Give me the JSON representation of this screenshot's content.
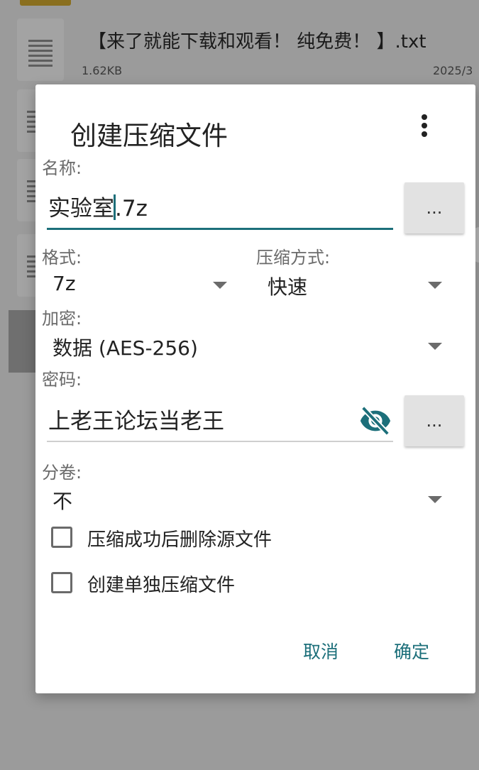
{
  "background": {
    "file_name": "【来了就能下载和观看！ 纯免费！ 】.txt",
    "file_size": "1.62KB",
    "file_date": "2025/3"
  },
  "dialog": {
    "title": "创建压缩文件",
    "name_label": "名称:",
    "name_value_before_caret": "实验室",
    "name_value_after_caret": ".7z",
    "browse_label": "...",
    "format_label": "格式:",
    "format_value": "7z",
    "method_label": "压缩方式:",
    "method_value": "快速",
    "encryption_label": "加密:",
    "encryption_value": "数据 (AES-256)",
    "password_label": "密码:",
    "password_value": "上老王论坛当老王",
    "password_btn_label": "...",
    "volume_label": "分卷:",
    "volume_value": "不",
    "checkbox_delete_source": "压缩成功后删除源文件",
    "checkbox_separate": "创建单独压缩文件",
    "cancel": "取消",
    "ok": "确定"
  },
  "colors": {
    "accent": "#1c6f7a",
    "dialog_bg": "#ffffff",
    "scrim": "#9b9b9b"
  },
  "icons": [
    "more-vert-icon",
    "eye-off-icon",
    "dropdown-arrow-icon",
    "txt-file-icon"
  ]
}
